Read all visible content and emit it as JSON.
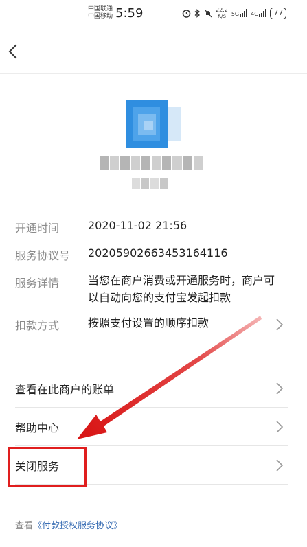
{
  "status_bar": {
    "carrier1": "中国联通",
    "carrier2": "中国移动",
    "time": "5:59",
    "net_speed_value": "22.2",
    "net_speed_unit": "K/s",
    "net_type1": "5G",
    "net_type2": "4G",
    "battery": "77"
  },
  "nav": {
    "back_icon": "chevron-left-icon"
  },
  "merchant": {
    "logo_icon": "merchant-logo-icon",
    "logo_color": "#2f8ee0"
  },
  "info": {
    "open_time_label": "开通时间",
    "open_time_value": "2020-11-02 21:56",
    "agreement_no_label": "服务协议号",
    "agreement_no_value": "20205902663453164116",
    "detail_label": "服务详情",
    "detail_line1": "当您在商户消费或开通服务时，商户可",
    "detail_line2": "以自动向您的支付宝发起扣款",
    "deduct_label": "扣款方式",
    "deduct_value": "按照支付设置的顺序扣款"
  },
  "menu": {
    "bills": "查看在此商户的账单",
    "help": "帮助中心",
    "close_service": "关闭服务"
  },
  "footer": {
    "prefix": "查看",
    "link": "《付款授权服务协议》"
  },
  "annotation": {
    "color": "#e01e1e"
  }
}
